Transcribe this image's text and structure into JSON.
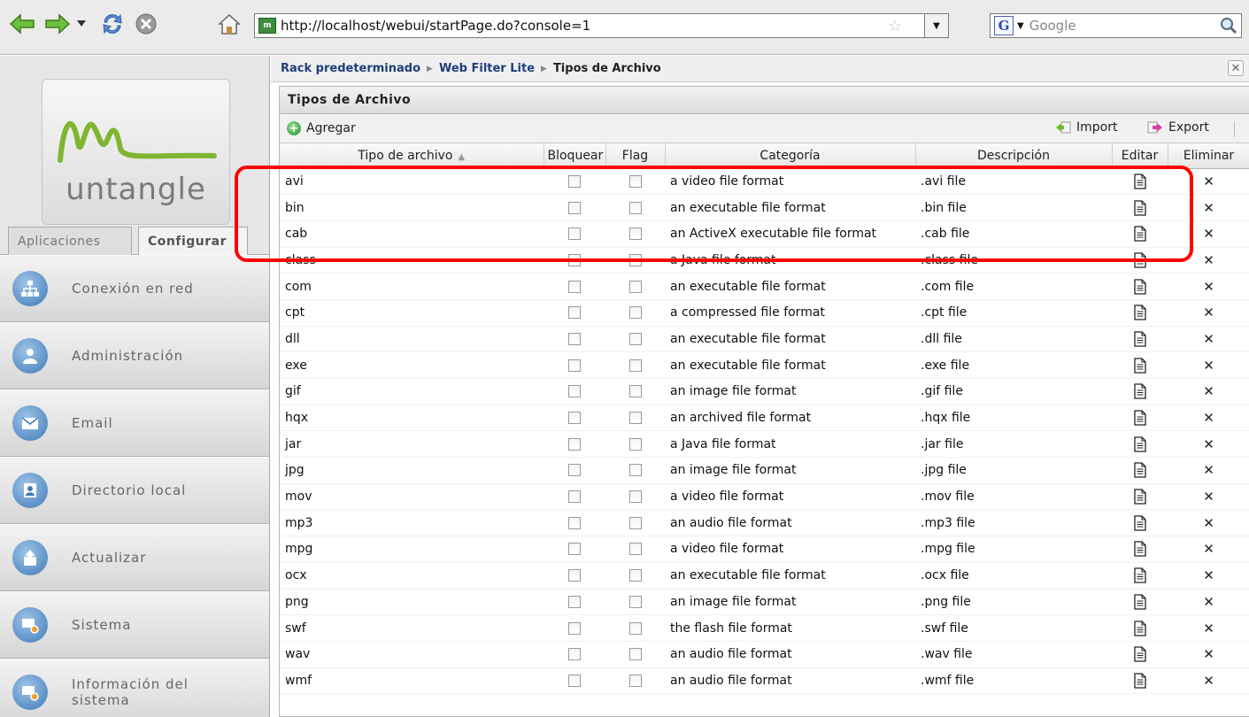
{
  "browser": {
    "url": "http://localhost/webui/startPage.do?console=1",
    "search_placeholder": "Google",
    "search_engine_letter": "G"
  },
  "sidebar": {
    "logo_text": "untangle",
    "tabs": [
      {
        "label": "Aplicaciones",
        "active": false
      },
      {
        "label": "Configurar",
        "active": true
      }
    ],
    "items": [
      {
        "label": "Conexión en red",
        "icon": "network-icon"
      },
      {
        "label": "Administración",
        "icon": "admin-icon"
      },
      {
        "label": "Email",
        "icon": "email-icon"
      },
      {
        "label": "Directorio local",
        "icon": "directory-icon"
      },
      {
        "label": "Actualizar",
        "icon": "upgrade-icon"
      },
      {
        "label": "Sistema",
        "icon": "system-icon"
      },
      {
        "label": "Información del sistema",
        "icon": "system-info-icon"
      }
    ]
  },
  "breadcrumb": {
    "items": [
      "Rack predeterminado",
      "Web Filter Lite",
      "Tipos de Archivo"
    ]
  },
  "grid": {
    "title": "Tipos de Archivo",
    "toolbar": {
      "add_label": "Agregar",
      "import_label": "Import",
      "export_label": "Export"
    },
    "columns": {
      "type": "Tipo de archivo",
      "block": "Bloquear",
      "flag": "Flag",
      "category": "Categoría",
      "description": "Descripción",
      "edit": "Editar",
      "delete": "Eliminar"
    },
    "rows": [
      {
        "type": "avi",
        "block": false,
        "flag": false,
        "category": "a video file format",
        "description": ".avi file"
      },
      {
        "type": "bin",
        "block": false,
        "flag": false,
        "category": "an executable file format",
        "description": ".bin file"
      },
      {
        "type": "cab",
        "block": false,
        "flag": false,
        "category": "an ActiveX executable file format",
        "description": ".cab file"
      },
      {
        "type": "class",
        "block": false,
        "flag": false,
        "category": "a Java file format",
        "description": ".class file"
      },
      {
        "type": "com",
        "block": false,
        "flag": false,
        "category": "an executable file format",
        "description": ".com file"
      },
      {
        "type": "cpt",
        "block": false,
        "flag": false,
        "category": "a compressed file format",
        "description": ".cpt file"
      },
      {
        "type": "dll",
        "block": false,
        "flag": false,
        "category": "an executable file format",
        "description": ".dll file"
      },
      {
        "type": "exe",
        "block": false,
        "flag": false,
        "category": "an executable file format",
        "description": ".exe file"
      },
      {
        "type": "gif",
        "block": false,
        "flag": false,
        "category": "an image file format",
        "description": ".gif file"
      },
      {
        "type": "hqx",
        "block": false,
        "flag": false,
        "category": "an archived file format",
        "description": ".hqx file"
      },
      {
        "type": "jar",
        "block": false,
        "flag": false,
        "category": "a Java file format",
        "description": ".jar file"
      },
      {
        "type": "jpg",
        "block": false,
        "flag": false,
        "category": "an image file format",
        "description": ".jpg file"
      },
      {
        "type": "mov",
        "block": false,
        "flag": false,
        "category": "a video file format",
        "description": ".mov file"
      },
      {
        "type": "mp3",
        "block": false,
        "flag": false,
        "category": "an audio file format",
        "description": ".mp3 file"
      },
      {
        "type": "mpg",
        "block": false,
        "flag": false,
        "category": "a video file format",
        "description": ".mpg file"
      },
      {
        "type": "ocx",
        "block": false,
        "flag": false,
        "category": "an executable file format",
        "description": ".ocx file"
      },
      {
        "type": "png",
        "block": false,
        "flag": false,
        "category": "an image file format",
        "description": ".png file"
      },
      {
        "type": "swf",
        "block": false,
        "flag": false,
        "category": "the flash file format",
        "description": ".swf file"
      },
      {
        "type": "wav",
        "block": false,
        "flag": false,
        "category": "an audio file format",
        "description": ".wav file"
      },
      {
        "type": "wmf",
        "block": false,
        "flag": false,
        "category": "an audio file format",
        "description": ".wmf file"
      }
    ]
  },
  "colors": {
    "highlight": "#ff0000",
    "crumb_link": "#1e3f7a"
  }
}
